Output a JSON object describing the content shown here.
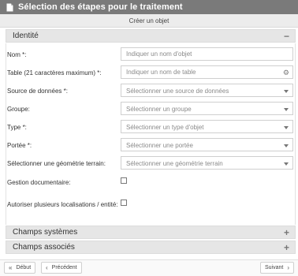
{
  "window": {
    "title": "Sélection des étapes pour le traitement"
  },
  "toolbar": {
    "subtitle": "Créer un objet"
  },
  "sections": {
    "identite": {
      "label": "Identité",
      "toggle": "−"
    },
    "champs_systemes": {
      "label": "Champs systèmes",
      "toggle": "+"
    },
    "champs_associes": {
      "label": "Champs associés",
      "toggle": "+"
    }
  },
  "form": {
    "nom": {
      "label": "Nom *:",
      "placeholder": "Indiquer un nom d'objet"
    },
    "table": {
      "label": "Table (21 caractères maximum) *:",
      "placeholder": "Indiquer un nom de table"
    },
    "source": {
      "label": "Source de données *:",
      "value": "Sélectionner une source de données"
    },
    "groupe": {
      "label": "Groupe:",
      "value": "Sélectionner un groupe"
    },
    "type": {
      "label": "Type *:",
      "value": "Sélectionner un type d'objet"
    },
    "portee": {
      "label": "Portée *:",
      "value": "Sélectionner une portée"
    },
    "geometrie": {
      "label": "Sélectionner une géométrie terrain:",
      "value": "Sélectionner une géométrie terrain"
    },
    "gestion_doc": {
      "label": "Gestion documentaire:",
      "checked": false
    },
    "multi_loc": {
      "label": "Autoriser plusieurs localisations / entité:",
      "checked": false
    }
  },
  "footer": {
    "debut": "Début",
    "precedent": "Précédent",
    "suivant": "Suivant"
  },
  "icons": {
    "title_icon": "document-icon",
    "table_field_icon": "gear-icon",
    "debut_icon": "double-chevron-left-icon",
    "precedent_icon": "chevron-left-icon",
    "suivant_icon": "chevron-right-icon"
  }
}
